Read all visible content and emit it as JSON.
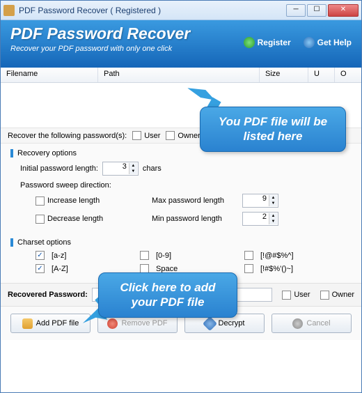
{
  "window": {
    "title": "PDF Password Recover ( Registered )"
  },
  "header": {
    "title": "PDF Password Recover",
    "subtitle": "Recover your PDF password with only one click",
    "register": "Register",
    "help": "Get Help"
  },
  "table": {
    "cols": {
      "filename": "Filename",
      "path": "Path",
      "size": "Size",
      "u": "U",
      "o": "O"
    }
  },
  "recover_row": {
    "label": "Recover the following password(s):",
    "user": "User",
    "owner": "Owner"
  },
  "recovery": {
    "title": "Recovery options",
    "init_label": "Initial password length:",
    "init_value": "3",
    "chars": "chars",
    "sweep_label": "Password sweep direction:",
    "increase": "Increase length",
    "decrease": "Decrease length",
    "max_label": "Max password length",
    "max_value": "9",
    "min_label": "Min password length",
    "min_value": "2"
  },
  "charset": {
    "title": "Charset options",
    "az": "[a-z]",
    "AZ_": "[A-Z]",
    "d09": "[0-9]",
    "space": "Space",
    "sym": "[!@#$%^]",
    "sym2": "[!#$%'()~]",
    "az_checked": "✓",
    "AZ_checked": "✓"
  },
  "recovered": {
    "label": "Recovered Password:",
    "user": "User",
    "owner": "Owner"
  },
  "buttons": {
    "add": "Add PDF file",
    "remove": "Remove PDF",
    "decrypt": "Decrypt",
    "cancel": "Cancel"
  },
  "callouts": {
    "c1": "You PDF file will be listed here",
    "c2": "Click here to add your PDF file"
  }
}
